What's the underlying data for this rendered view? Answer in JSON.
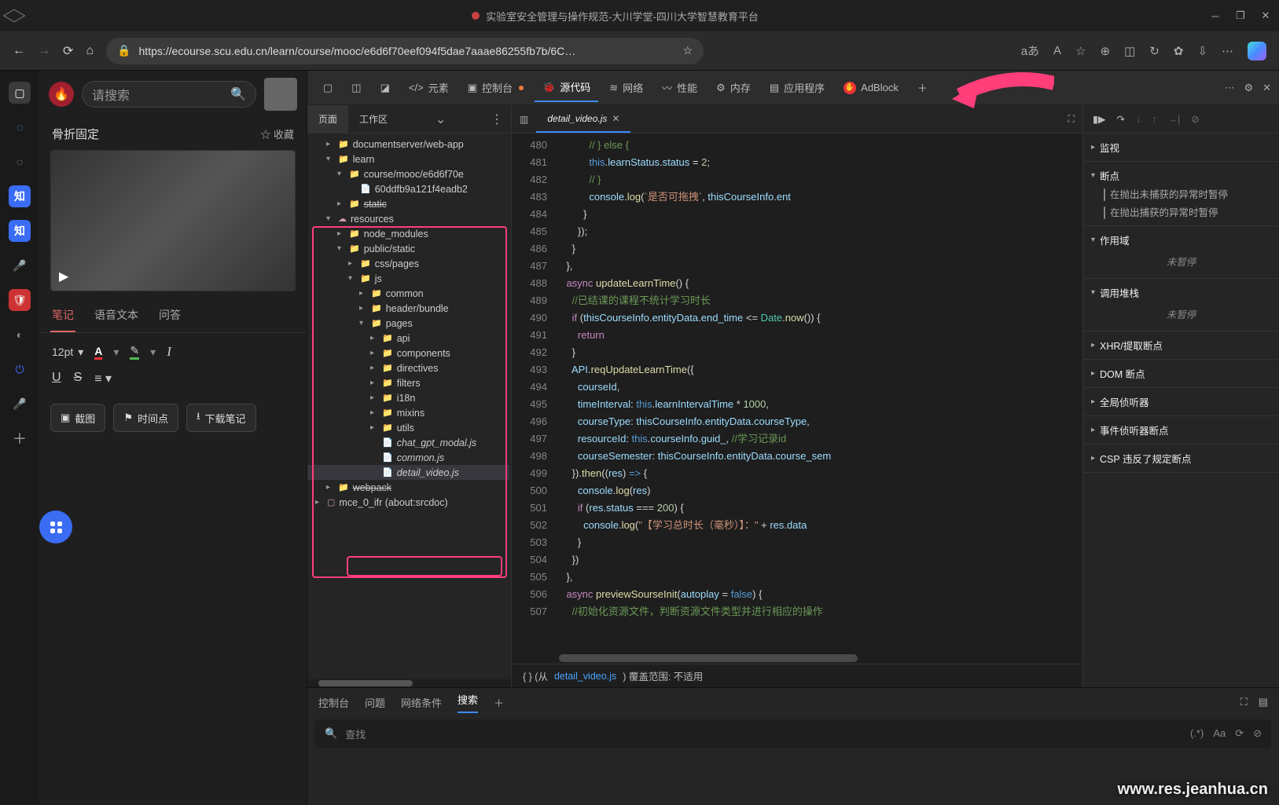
{
  "titlebar": {
    "title": "实验室安全管理与操作规范-大川学堂-四川大学智慧教育平台"
  },
  "nav": {
    "url_text": "https://ecourse.scu.edu.cn/learn/course/mooc/e6d6f70eef094f5dae7aaae86255fb7b/6C…",
    "aa_label": "aあ",
    "font_label": "A"
  },
  "app": {
    "search_placeholder": "请搜索",
    "crumb": "骨折固定",
    "fav_label": "☆ 收藏",
    "tabs": {
      "notes": "笔记",
      "voice": "语音文本",
      "qa": "问答"
    },
    "fontsize": "12pt",
    "btn1": "截图",
    "btn2": "时间点",
    "btn3": "下载笔记"
  },
  "devtabs": {
    "elements": "元素",
    "console": "控制台",
    "sources": "源代码",
    "network": "网络",
    "performance": "性能",
    "memory": "内存",
    "application": "应用程序",
    "adblock": "AdBlock"
  },
  "sources": {
    "page_tab": "页面",
    "workspace_tab": "工作区",
    "tree": [
      {
        "d": 1,
        "arw": "▸",
        "ic": "📁",
        "txt": "documentserver/web-app"
      },
      {
        "d": 1,
        "arw": "▾",
        "ic": "📁",
        "txt": "learn"
      },
      {
        "d": 2,
        "arw": "▾",
        "ic": "📁",
        "txt": "course/mooc/e6d6f70e"
      },
      {
        "d": 3,
        "arw": "",
        "ic": "📄",
        "txt": "60ddfb9a121f4eadb2"
      },
      {
        "d": 2,
        "arw": "▸",
        "ic": "📁",
        "txt": "static",
        "strike": true
      },
      {
        "d": 1,
        "arw": "▾",
        "ic": "☁",
        "txt": "resources"
      },
      {
        "d": 2,
        "arw": "▸",
        "ic": "📁",
        "txt": "node_modules"
      },
      {
        "d": 2,
        "arw": "▾",
        "ic": "📁",
        "txt": "public/static"
      },
      {
        "d": 3,
        "arw": "▸",
        "ic": "📁",
        "txt": "css/pages"
      },
      {
        "d": 3,
        "arw": "▾",
        "ic": "📁",
        "txt": "js"
      },
      {
        "d": 4,
        "arw": "▸",
        "ic": "📁",
        "txt": "common"
      },
      {
        "d": 4,
        "arw": "▸",
        "ic": "📁",
        "txt": "header/bundle"
      },
      {
        "d": 4,
        "arw": "▾",
        "ic": "📁",
        "txt": "pages"
      },
      {
        "d": 5,
        "arw": "▸",
        "ic": "📁",
        "txt": "api"
      },
      {
        "d": 5,
        "arw": "▸",
        "ic": "📁",
        "txt": "components"
      },
      {
        "d": 5,
        "arw": "▸",
        "ic": "📁",
        "txt": "directives"
      },
      {
        "d": 5,
        "arw": "▸",
        "ic": "📁",
        "txt": "filters"
      },
      {
        "d": 5,
        "arw": "▸",
        "ic": "📁",
        "txt": "i18n"
      },
      {
        "d": 5,
        "arw": "▸",
        "ic": "📁",
        "txt": "mixins"
      },
      {
        "d": 5,
        "arw": "▸",
        "ic": "📁",
        "txt": "utils"
      },
      {
        "d": 5,
        "arw": "",
        "ic": "📄",
        "txt": "chat_gpt_modal.js",
        "italic": true
      },
      {
        "d": 5,
        "arw": "",
        "ic": "📄",
        "txt": "common.js",
        "italic": true
      },
      {
        "d": 5,
        "arw": "",
        "ic": "📄",
        "txt": "detail_video.js",
        "italic": true,
        "sel": true
      },
      {
        "d": 1,
        "arw": "▸",
        "ic": "📁",
        "txt": "webpack",
        "strike": true
      },
      {
        "d": 0,
        "arw": "▸",
        "ic": "▢",
        "txt": "mce_0_ifr (about:srcdoc)"
      }
    ]
  },
  "editor": {
    "open_file": "detail_video.js",
    "lines": [
      {
        "n": 480,
        "h": "            <span class='c-c'>// } else {</span>"
      },
      {
        "n": 481,
        "h": "            <span class='c-o'>this</span>.<span class='c-p'>learnStatus</span>.<span class='c-p'>status</span> = <span class='c-n'>2</span>;"
      },
      {
        "n": 482,
        "h": "            <span class='c-c'>// }</span>"
      },
      {
        "n": 483,
        "h": "            <span class='c-p'>console</span>.<span class='c-f'>log</span>(<span class='c-s'>`是否可拖拽`</span>, <span class='c-p'>thisCourseInfo</span>.<span class='c-p'>ent</span>"
      },
      {
        "n": 484,
        "h": "          }"
      },
      {
        "n": 485,
        "h": "        });"
      },
      {
        "n": 486,
        "h": "      }"
      },
      {
        "n": 487,
        "h": "    },"
      },
      {
        "n": 488,
        "h": "    <span class='c-k'>async</span> <span class='c-f'>updateLearnTime</span>() {"
      },
      {
        "n": 489,
        "h": "      <span class='c-c'>//已结课的课程不统计学习时长</span>"
      },
      {
        "n": 490,
        "h": "      <span class='c-k'>if</span> (<span class='c-p'>thisCourseInfo</span>.<span class='c-p'>entityData</span>.<span class='c-p'>end_time</span> &lt;= <span class='c-t'>Date</span>.<span class='c-f'>now</span>()) {"
      },
      {
        "n": 491,
        "h": "        <span class='c-k'>return</span>"
      },
      {
        "n": 492,
        "h": "      }"
      },
      {
        "n": 493,
        "h": "      <span class='c-p'>API</span>.<span class='c-f'>reqUpdateLearnTime</span>({"
      },
      {
        "n": 494,
        "h": "        <span class='c-p'>courseId</span>,"
      },
      {
        "n": 495,
        "h": "        <span class='c-p'>timeInterval</span>: <span class='c-o'>this</span>.<span class='c-p'>learnIntervalTime</span> * <span class='c-n'>1000</span>,"
      },
      {
        "n": 496,
        "h": "        <span class='c-p'>courseType</span>: <span class='c-p'>thisCourseInfo</span>.<span class='c-p'>entityData</span>.<span class='c-p'>courseType</span>,"
      },
      {
        "n": 497,
        "h": "        <span class='c-p'>resourceId</span>: <span class='c-o'>this</span>.<span class='c-p'>courseInfo</span>.<span class='c-p'>guid_</span>, <span class='c-c'>//学习记录id</span>"
      },
      {
        "n": 498,
        "h": "        <span class='c-p'>courseSemester</span>: <span class='c-p'>thisCourseInfo</span>.<span class='c-p'>entityData</span>.<span class='c-p'>course_sem</span>"
      },
      {
        "n": 499,
        "h": "      }).<span class='c-f'>then</span>((<span class='c-p'>res</span>) <span class='c-o'>=&gt;</span> {"
      },
      {
        "n": 500,
        "h": "        <span class='c-p'>console</span>.<span class='c-f'>log</span>(<span class='c-p'>res</span>)"
      },
      {
        "n": 501,
        "h": "        <span class='c-k'>if</span> (<span class='c-p'>res</span>.<span class='c-p'>status</span> === <span class='c-n'>200</span>) {"
      },
      {
        "n": 502,
        "h": "          <span class='c-p'>console</span>.<span class='c-f'>log</span>(<span class='c-s'>\"【学习总时长（毫秒）】：\"</span> + <span class='c-p'>res</span>.<span class='c-p'>data</span>"
      },
      {
        "n": 503,
        "h": "        }"
      },
      {
        "n": 504,
        "h": "      })"
      },
      {
        "n": 505,
        "h": "    },"
      },
      {
        "n": 506,
        "h": "    <span class='c-k'>async</span> <span class='c-f'>previewSourseInit</span>(<span class='c-p'>autoplay</span> = <span class='c-o'>false</span>) {"
      },
      {
        "n": 507,
        "h": "      <span class='c-c'>//初始化资源文件，判断资源文件类型并进行相应的操作</span>"
      }
    ],
    "status_prefix": "{ }  (从",
    "status_link": "detail_video.js",
    "status_suffix": ")  覆盖范围: 不适用"
  },
  "debugger": {
    "watch": "监视",
    "breakpoints": "断点",
    "bp1": "在抛出未捕获的异常时暂停",
    "bp2": "在抛出捕获的异常时暂停",
    "scope": "作用域",
    "not_paused": "未暂停",
    "callstack": "调用堆栈",
    "xhr": "XHR/提取断点",
    "dom": "DOM 断点",
    "listeners": "全局侦听器",
    "event_bp": "事件侦听器断点",
    "csp": "CSP 违反了规定断点"
  },
  "drawer": {
    "console": "控制台",
    "issues": "问题",
    "network": "网络条件",
    "search": "搜索",
    "find": "查找",
    "regex_label": "(.*)",
    "case_label": "Aa"
  },
  "watermark": "www.res.jeanhua.cn"
}
